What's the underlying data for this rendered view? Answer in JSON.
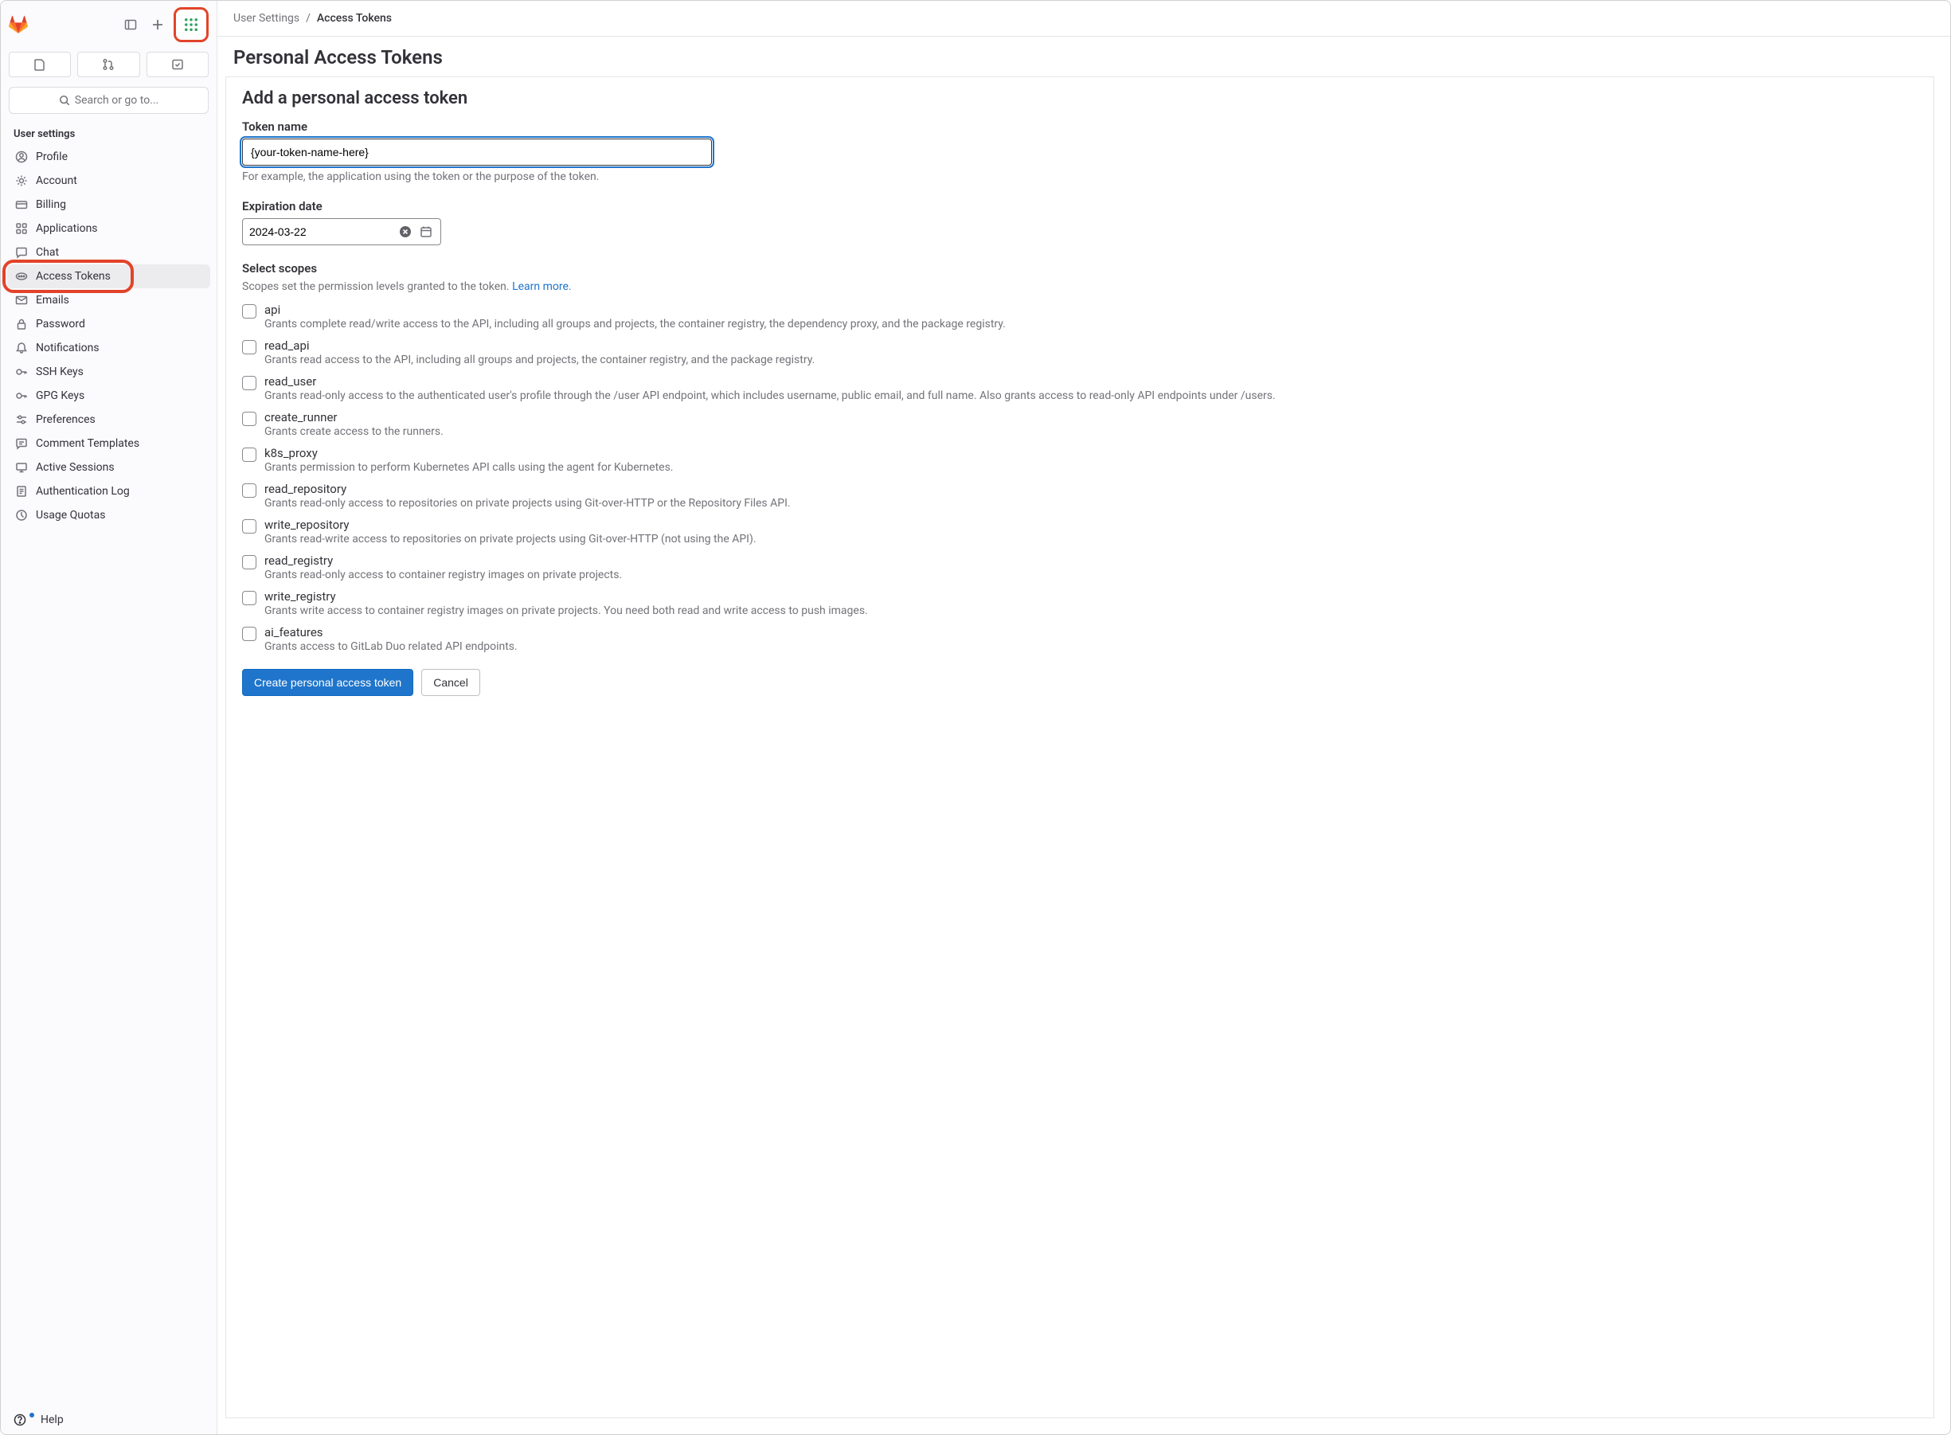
{
  "sidebar": {
    "search_placeholder": "Search or go to...",
    "section_header": "User settings",
    "items": [
      {
        "label": "Profile",
        "icon": "profile-icon"
      },
      {
        "label": "Account",
        "icon": "account-icon"
      },
      {
        "label": "Billing",
        "icon": "billing-icon"
      },
      {
        "label": "Applications",
        "icon": "applications-icon"
      },
      {
        "label": "Chat",
        "icon": "chat-icon"
      },
      {
        "label": "Access Tokens",
        "icon": "token-icon"
      },
      {
        "label": "Emails",
        "icon": "emails-icon"
      },
      {
        "label": "Password",
        "icon": "password-icon"
      },
      {
        "label": "Notifications",
        "icon": "notifications-icon"
      },
      {
        "label": "SSH Keys",
        "icon": "ssh-keys-icon"
      },
      {
        "label": "GPG Keys",
        "icon": "gpg-keys-icon"
      },
      {
        "label": "Preferences",
        "icon": "preferences-icon"
      },
      {
        "label": "Comment Templates",
        "icon": "comment-templates-icon"
      },
      {
        "label": "Active Sessions",
        "icon": "active-sessions-icon"
      },
      {
        "label": "Authentication Log",
        "icon": "auth-log-icon"
      },
      {
        "label": "Usage Quotas",
        "icon": "usage-quotas-icon"
      }
    ],
    "help_label": "Help"
  },
  "breadcrumb": {
    "parent": "User Settings",
    "current": "Access Tokens"
  },
  "page_title": "Personal Access Tokens",
  "form": {
    "heading": "Add a personal access token",
    "token_name_label": "Token name",
    "token_name_value": "{your-token-name-here}",
    "token_name_help": "For example, the application using the token or the purpose of the token.",
    "expiration_label": "Expiration date",
    "expiration_value": "2024-03-22",
    "scopes_label": "Select scopes",
    "scopes_desc": "Scopes set the permission levels granted to the token. ",
    "scopes_learn_more": "Learn more.",
    "scopes": [
      {
        "name": "api",
        "desc": "Grants complete read/write access to the API, including all groups and projects, the container registry, the dependency proxy, and the package registry."
      },
      {
        "name": "read_api",
        "desc": "Grants read access to the API, including all groups and projects, the container registry, and the package registry."
      },
      {
        "name": "read_user",
        "desc": "Grants read-only access to the authenticated user's profile through the /user API endpoint, which includes username, public email, and full name. Also grants access to read-only API endpoints under /users."
      },
      {
        "name": "create_runner",
        "desc": "Grants create access to the runners."
      },
      {
        "name": "k8s_proxy",
        "desc": "Grants permission to perform Kubernetes API calls using the agent for Kubernetes."
      },
      {
        "name": "read_repository",
        "desc": "Grants read-only access to repositories on private projects using Git-over-HTTP or the Repository Files API."
      },
      {
        "name": "write_repository",
        "desc": "Grants read-write access to repositories on private projects using Git-over-HTTP (not using the API)."
      },
      {
        "name": "read_registry",
        "desc": "Grants read-only access to container registry images on private projects."
      },
      {
        "name": "write_registry",
        "desc": "Grants write access to container registry images on private projects. You need both read and write access to push images."
      },
      {
        "name": "ai_features",
        "desc": "Grants access to GitLab Duo related API endpoints."
      }
    ],
    "submit_label": "Create personal access token",
    "cancel_label": "Cancel"
  }
}
